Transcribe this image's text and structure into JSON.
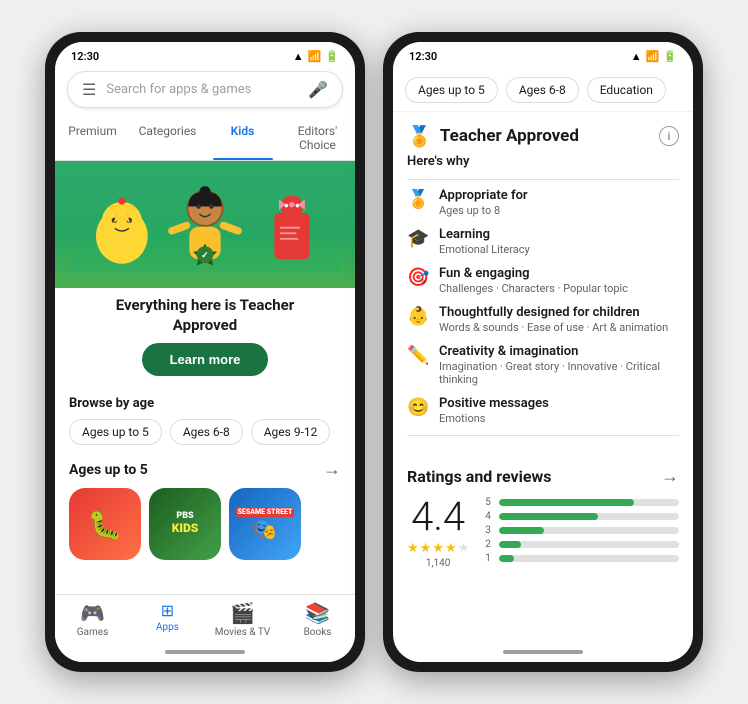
{
  "phone1": {
    "status": {
      "time": "12:30"
    },
    "search": {
      "placeholder": "Search for apps & games"
    },
    "nav": {
      "tabs": [
        "Premium",
        "Categories",
        "Kids",
        "Editors' Choice"
      ],
      "active": "Kids"
    },
    "hero": {
      "title": "Everything here is Teacher",
      "title2": "Approved",
      "button": "Learn more"
    },
    "browse": {
      "title": "Browse by age",
      "chips": [
        "Ages up to 5",
        "Ages 6-8",
        "Ages 9-12"
      ]
    },
    "ages_section": {
      "title": "Ages up to 5"
    },
    "bottom_nav": [
      {
        "label": "Games",
        "icon": "🎮"
      },
      {
        "label": "Apps",
        "icon": "⊞"
      },
      {
        "label": "Movies & TV",
        "icon": "🎬"
      },
      {
        "label": "Books",
        "icon": "📚"
      }
    ]
  },
  "phone2": {
    "status": {
      "time": "12:30"
    },
    "filter_chips": [
      "Ages up to 5",
      "Ages 6-8",
      "Education"
    ],
    "teacher": {
      "title": "Teacher Approved",
      "heres_why": "Here's why",
      "criteria": [
        {
          "icon": "🏅",
          "label": "Appropriate for",
          "sub": "Ages up to 8"
        },
        {
          "icon": "🎓",
          "label": "Learning",
          "sub": "Emotional Literacy"
        },
        {
          "icon": "🎯",
          "label": "Fun & engaging",
          "sub": "Challenges · Characters · Popular topic"
        },
        {
          "icon": "👶",
          "label": "Thoughtfully designed for children",
          "sub": "Words & sounds · Ease of use · Art & animation"
        },
        {
          "icon": "✏️",
          "label": "Creativity & imagination",
          "sub": "Imagination · Great story · Innovative · Critical thinking"
        },
        {
          "icon": "😊",
          "label": "Positive messages",
          "sub": "Emotions"
        }
      ]
    },
    "ratings": {
      "title": "Ratings and reviews",
      "score": "4.4",
      "count": "1,140",
      "bars": [
        {
          "label": "5",
          "pct": 75
        },
        {
          "label": "4",
          "pct": 55
        },
        {
          "label": "3",
          "pct": 25
        },
        {
          "label": "2",
          "pct": 12
        },
        {
          "label": "1",
          "pct": 8
        }
      ]
    }
  },
  "colors": {
    "green": "#1a7340",
    "blue": "#1a73e8",
    "star": "#fbbc04"
  }
}
